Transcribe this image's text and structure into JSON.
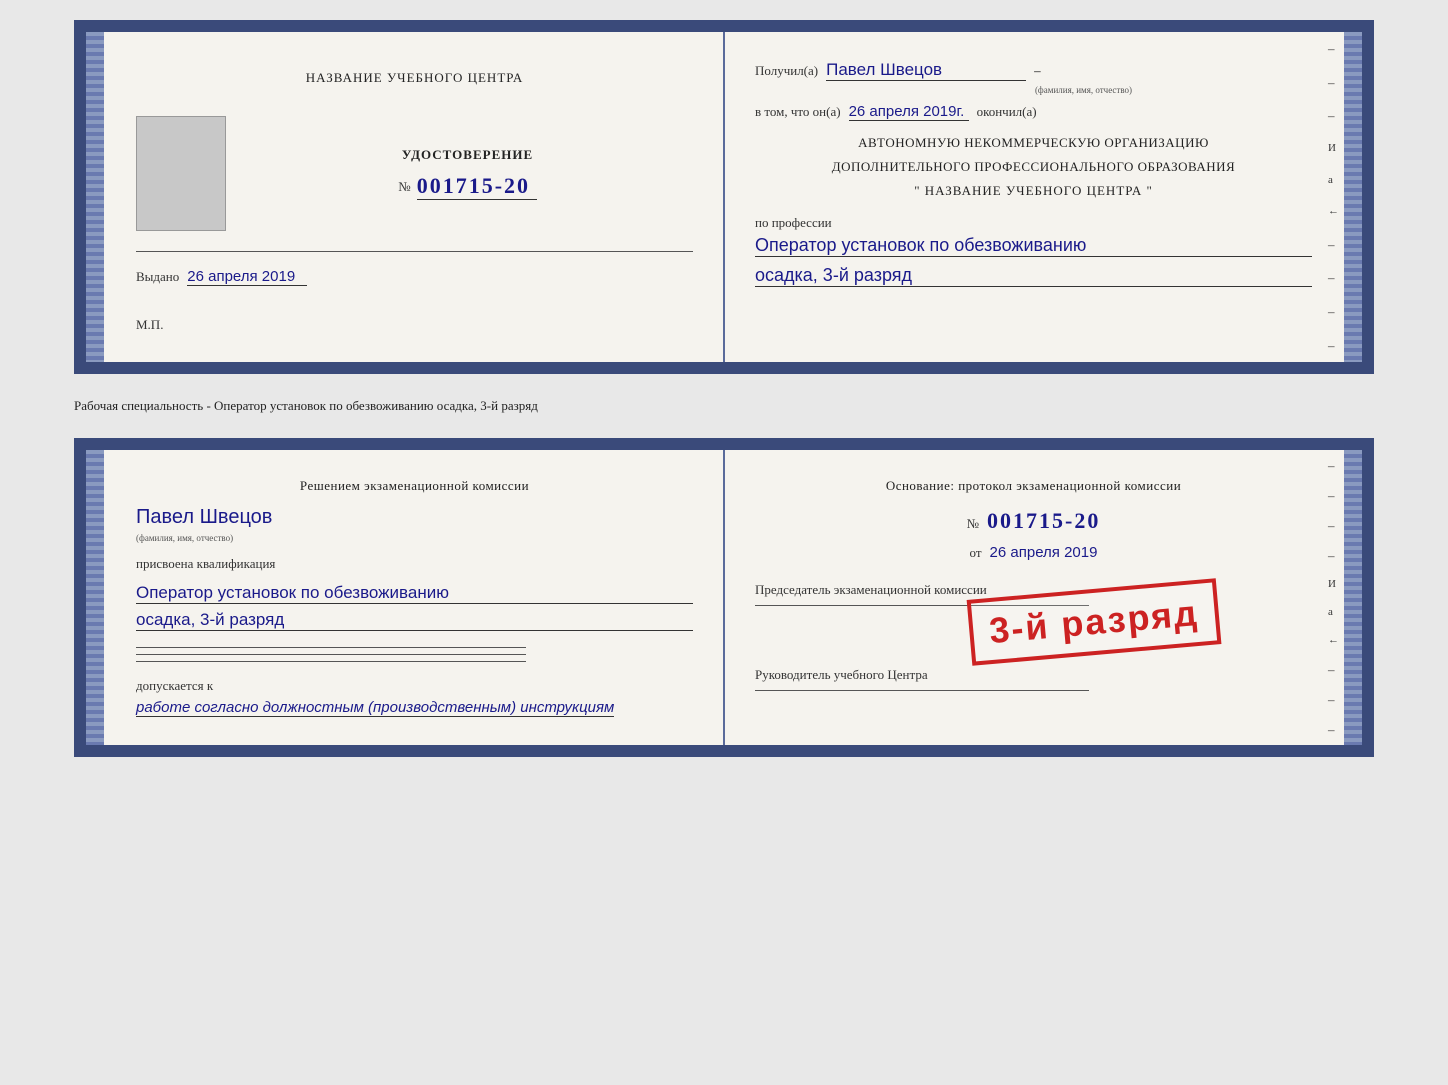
{
  "top_doc": {
    "left": {
      "title": "НАЗВАНИЕ УЧЕБНОГО ЦЕНТРА",
      "cert_label": "УДОСТОВЕРЕНИЕ",
      "cert_number_prefix": "№",
      "cert_number": "001715-20",
      "issued_label": "Выдано",
      "issued_date": "26 апреля 2019",
      "mp_label": "М.П."
    },
    "right": {
      "received_label": "Получил(а)",
      "recipient_name": "Павел Швецов",
      "fio_caption": "(фамилия, имя, отчество)",
      "dash": "–",
      "in_that_label": "в том, что он(а)",
      "completion_date": "26 апреля 2019г.",
      "finished_label": "окончил(а)",
      "org_line1": "АВТОНОМНУЮ НЕКОММЕРЧЕСКУЮ ОРГАНИЗАЦИЮ",
      "org_line2": "ДОПОЛНИТЕЛЬНОГО ПРОФЕССИОНАЛЬНОГО ОБРАЗОВАНИЯ",
      "org_quote1": "\"",
      "org_name": "НАЗВАНИЕ УЧЕБНОГО ЦЕНТРА",
      "org_quote2": "\"",
      "profession_label": "по профессии",
      "profession_value": "Оператор установок по обезвоживанию",
      "rank_value": "осадка, 3-й разряд"
    }
  },
  "separator": "Рабочая специальность - Оператор установок по обезвоживанию осадка, 3-й разряд",
  "bottom_doc": {
    "left": {
      "decision_label": "Решением экзаменационной комиссии",
      "person_name": "Павел Швецов",
      "fio_caption": "(фамилия, имя, отчество)",
      "assigned_label": "присвоена квалификация",
      "profession_value": "Оператор установок по обезвоживанию",
      "rank_value": "осадка, 3-й разряд",
      "allowed_label": "допускается к",
      "allowed_value": "работе согласно должностным (производственным) инструкциям"
    },
    "right": {
      "basis_label": "Основание: протокол экзаменационной комиссии",
      "number_prefix": "№",
      "number_value": "001715-20",
      "date_prefix": "от",
      "date_value": "26 апреля 2019",
      "chairman_label": "Председатель экзаменационной комиссии",
      "director_label": "Руководитель учебного Центра"
    },
    "stamp": "3-й разряд"
  }
}
